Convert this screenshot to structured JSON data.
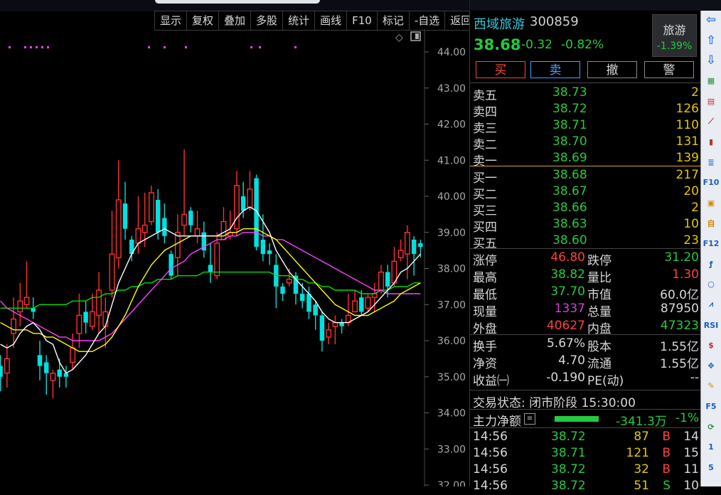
{
  "toolbar": [
    "显示",
    "复权",
    "叠加",
    "多股",
    "统计",
    "画线",
    "F10",
    "标记",
    "-自选",
    "返回"
  ],
  "stock": {
    "name": "西域旅游",
    "code": "300859",
    "price": "38.68",
    "change": "-0.32",
    "change_pct": "-0.82%"
  },
  "sector": {
    "name": "旅游",
    "change": "-1.39%"
  },
  "trade_buttons": [
    "买",
    "卖",
    "撤",
    "警"
  ],
  "asks": [
    {
      "label": "卖五",
      "price": "38.73",
      "vol": "2"
    },
    {
      "label": "卖四",
      "price": "38.72",
      "vol": "126"
    },
    {
      "label": "卖三",
      "price": "38.71",
      "vol": "110"
    },
    {
      "label": "卖二",
      "price": "38.70",
      "vol": "131"
    },
    {
      "label": "卖一",
      "price": "38.69",
      "vol": "139"
    }
  ],
  "bids": [
    {
      "label": "买一",
      "price": "38.68",
      "vol": "217"
    },
    {
      "label": "买二",
      "price": "38.67",
      "vol": "20"
    },
    {
      "label": "买三",
      "price": "38.66",
      "vol": "2"
    },
    {
      "label": "买四",
      "price": "38.63",
      "vol": "10"
    },
    {
      "label": "买五",
      "price": "38.60",
      "vol": "23"
    }
  ],
  "quotes_left": [
    {
      "label": "涨停",
      "value": "46.80",
      "color": "#ff4040"
    },
    {
      "label": "最高",
      "value": "38.82",
      "color": "#27c93f"
    },
    {
      "label": "最低",
      "value": "37.70",
      "color": "#27c93f"
    },
    {
      "label": "现量",
      "value": "1337",
      "color": "#d040d8"
    },
    {
      "label": "外盘",
      "value": "40627",
      "color": "#ff4040"
    }
  ],
  "quotes_right": [
    {
      "label": "跌停",
      "value": "31.20",
      "color": "#27c93f"
    },
    {
      "label": "量比",
      "value": "1.30",
      "color": "#ff4040"
    },
    {
      "label": "市值",
      "value": "60.0亿",
      "color": "#d8d8d8"
    },
    {
      "label": "总量",
      "value": "87950",
      "color": "#d8d8d8"
    },
    {
      "label": "内盘",
      "value": "47323",
      "color": "#27c93f"
    }
  ],
  "fund_left": [
    {
      "label": "换手",
      "value": "5.67%"
    },
    {
      "label": "净资",
      "value": "4.70"
    },
    {
      "label": "收益㈠",
      "value": "-0.190"
    }
  ],
  "fund_right": [
    {
      "label": "股本",
      "value": "1.55亿"
    },
    {
      "label": "流通",
      "value": "1.55亿"
    },
    {
      "label": "PE(动)",
      "value": "--"
    }
  ],
  "trade_status": "交易状态: 闭市阶段 15:30:00",
  "main_flow": {
    "label": "主力净额",
    "amount": "-341.3万",
    "pct": "-1%"
  },
  "ticks": [
    {
      "time": "14:56",
      "price": "38.72",
      "vol": "87",
      "bs": "B",
      "n": "14"
    },
    {
      "time": "14:56",
      "price": "38.71",
      "vol": "121",
      "bs": "B",
      "n": "15"
    },
    {
      "time": "14:56",
      "price": "38.72",
      "vol": "32",
      "bs": "B",
      "n": "11"
    },
    {
      "time": "14:56",
      "price": "38.72",
      "vol": "51",
      "bs": "S",
      "n": "10"
    }
  ],
  "sidebar_icons": [
    "arrow-left-icon",
    "arrow-up-icon",
    "arrow-down-icon",
    "grid-chart-icon",
    "table-icon",
    "line-chart-icon",
    "candle-icon",
    "list-icon",
    "f10-icon",
    "news-icon",
    "self-select-icon",
    "f12-icon",
    "formula-icon",
    "circle-icon",
    "indicator-icon",
    "rsi-icon",
    "money-icon",
    "move-icon",
    "pen-icon",
    "f5-icon",
    "refresh-icon",
    "num-1-icon",
    "num-5-icon"
  ],
  "sidebar_text": [
    "⇦",
    "⇧",
    "⇩",
    "▦",
    "▤",
    "⟋",
    "▮",
    "≣",
    "F10",
    "▣",
    "自",
    "F12",
    "ƒ",
    "○",
    "⩘",
    "RSI",
    "$",
    "✥",
    "✎",
    "F5",
    "⟳",
    "1",
    "5"
  ],
  "chart_data": {
    "type": "candlestick",
    "ylim": [
      32,
      44
    ],
    "y_ticks": [
      "44.00",
      "43.00",
      "42.00",
      "41.00",
      "40.00",
      "39.00",
      "38.00",
      "37.00",
      "36.00",
      "35.00",
      "34.00",
      "33.00",
      "32.00"
    ],
    "colors": {
      "up": "#ff3030",
      "down": "#00e0e0",
      "ma5": "#ffffff",
      "ma10": "#ffff00",
      "ma20": "#ff40ff",
      "ma60": "#00e000"
    },
    "candles": [
      [
        35.3,
        35.0,
        35.6,
        34.6
      ],
      [
        35.1,
        35.5,
        35.9,
        34.7
      ],
      [
        36.2,
        36.6,
        37.2,
        35.8
      ],
      [
        36.8,
        37.1,
        37.6,
        36.4
      ],
      [
        37.0,
        37.2,
        38.2,
        36.9
      ],
      [
        36.9,
        36.8,
        37.2,
        36.6
      ],
      [
        35.6,
        35.3,
        36.0,
        34.9
      ],
      [
        35.4,
        35.1,
        35.6,
        34.5
      ],
      [
        34.9,
        35.1,
        35.2,
        34.4
      ],
      [
        35.2,
        35.0,
        35.5,
        34.7
      ],
      [
        35.1,
        35.0,
        35.3,
        34.7
      ],
      [
        35.4,
        35.8,
        36.2,
        35.2
      ],
      [
        36.2,
        36.7,
        37.3,
        35.8
      ],
      [
        36.8,
        36.5,
        37.1,
        36.2
      ],
      [
        36.4,
        36.8,
        37.3,
        36.3
      ],
      [
        36.7,
        37.4,
        37.9,
        36.2
      ],
      [
        36.4,
        36.8,
        37.2,
        35.8
      ],
      [
        37.4,
        38.4,
        39.6,
        37.2
      ],
      [
        38.3,
        39.9,
        41.0,
        38.0
      ],
      [
        39.8,
        39.1,
        40.4,
        38.8
      ],
      [
        38.8,
        38.4,
        38.9,
        38.2
      ],
      [
        38.7,
        39.1,
        40.0,
        38.4
      ],
      [
        39.0,
        39.2,
        40.1,
        38.6
      ],
      [
        39.3,
        40.1,
        40.3,
        39.2
      ],
      [
        39.9,
        39.0,
        40.2,
        38.8
      ],
      [
        39.4,
        38.9,
        39.8,
        38.7
      ],
      [
        38.4,
        37.8,
        38.5,
        37.7
      ],
      [
        38.3,
        39.0,
        39.5,
        37.8
      ],
      [
        39.2,
        39.5,
        41.3,
        38.9
      ],
      [
        39.6,
        39.2,
        39.7,
        39.0
      ],
      [
        38.9,
        39.1,
        39.6,
        38.7
      ],
      [
        39.0,
        38.5,
        39.3,
        38.3
      ],
      [
        38.1,
        37.9,
        38.7,
        37.6
      ],
      [
        37.8,
        38.7,
        39.0,
        37.7
      ],
      [
        38.8,
        39.3,
        39.7,
        38.8
      ],
      [
        38.9,
        39.0,
        39.6,
        38.8
      ],
      [
        39.1,
        40.3,
        40.7,
        38.9
      ],
      [
        40.0,
        39.6,
        40.4,
        39.4
      ],
      [
        39.7,
        40.2,
        40.7,
        39.6
      ],
      [
        40.5,
        38.6,
        40.6,
        38.5
      ],
      [
        38.8,
        38.4,
        39.5,
        38.2
      ],
      [
        38.5,
        38.4,
        38.7,
        38.1
      ],
      [
        38.1,
        37.5,
        38.4,
        36.9
      ],
      [
        37.5,
        37.3,
        37.6,
        37.1
      ],
      [
        37.6,
        37.7,
        38.0,
        37.5
      ],
      [
        37.8,
        37.3,
        37.9,
        37.0
      ],
      [
        37.3,
        37.1,
        37.6,
        36.9
      ],
      [
        37.3,
        36.8,
        37.5,
        36.6
      ],
      [
        37.0,
        36.7,
        37.1,
        36.3
      ],
      [
        36.7,
        36.0,
        36.8,
        35.7
      ],
      [
        36.1,
        36.3,
        36.5,
        35.9
      ],
      [
        36.4,
        36.5,
        36.7,
        35.9
      ],
      [
        36.5,
        36.4,
        36.6,
        36.2
      ],
      [
        36.5,
        36.7,
        37.3,
        36.4
      ],
      [
        36.8,
        37.1,
        37.4,
        36.8
      ],
      [
        37.2,
        36.8,
        37.4,
        36.7
      ],
      [
        36.9,
        37.2,
        37.3,
        36.8
      ],
      [
        37.2,
        37.3,
        37.6,
        36.8
      ],
      [
        37.4,
        37.9,
        38.1,
        37.3
      ],
      [
        37.9,
        37.5,
        38.1,
        37.2
      ],
      [
        37.6,
        38.2,
        38.6,
        37.5
      ],
      [
        38.3,
        38.5,
        38.8,
        38.2
      ],
      [
        38.4,
        39.0,
        39.2,
        37.7
      ],
      [
        38.8,
        38.4,
        38.9,
        37.8
      ],
      [
        38.7,
        38.6,
        38.8,
        38.3
      ]
    ],
    "ma5": [
      35.9,
      35.8,
      35.9,
      36.2,
      36.4,
      36.5,
      36.3,
      36.0,
      35.9,
      35.4,
      35.1,
      35.2,
      35.4,
      35.6,
      35.9,
      36.2,
      36.4,
      37.0,
      37.6,
      38.0,
      38.4,
      38.7,
      38.8,
      38.9,
      39.0,
      39.1,
      39.0,
      38.9,
      38.9,
      38.9,
      38.9,
      38.9,
      38.9,
      38.9,
      39.0,
      39.1,
      39.4,
      39.6,
      39.7,
      39.6,
      39.3,
      39.0,
      38.5,
      38.2,
      37.9,
      37.7,
      37.5,
      37.3,
      37.1,
      36.8,
      36.6,
      36.5,
      36.5,
      36.5,
      36.6,
      36.7,
      36.8,
      37.0,
      37.2,
      37.4,
      37.6,
      37.9,
      38.0,
      38.2,
      38.4
    ],
    "ma10": [
      36.5,
      36.4,
      36.3,
      36.3,
      36.3,
      36.2,
      36.2,
      36.1,
      36.1,
      36.0,
      35.9,
      35.8,
      35.7,
      35.7,
      35.7,
      35.8,
      35.9,
      36.1,
      36.4,
      36.7,
      37.1,
      37.5,
      37.8,
      38.1,
      38.3,
      38.5,
      38.6,
      38.7,
      38.8,
      38.9,
      38.9,
      38.9,
      38.9,
      38.9,
      38.9,
      39.0,
      39.0,
      39.1,
      39.1,
      39.1,
      39.0,
      38.9,
      38.8,
      38.6,
      38.4,
      38.2,
      38.0,
      37.8,
      37.6,
      37.4,
      37.2,
      37.0,
      36.9,
      36.8,
      36.7,
      36.7,
      36.7,
      36.8,
      36.9,
      37.0,
      37.1,
      37.3,
      37.4,
      37.5,
      37.6
    ],
    "ma20": [
      37.1,
      36.9,
      36.8,
      36.7,
      36.6,
      36.5,
      36.4,
      36.3,
      36.2,
      36.1,
      36.1,
      36.0,
      36.0,
      36.0,
      36.0,
      36.0,
      36.1,
      36.2,
      36.4,
      36.6,
      36.8,
      37.0,
      37.2,
      37.4,
      37.6,
      37.8,
      38.0,
      38.1,
      38.2,
      38.4,
      38.5,
      38.6,
      38.7,
      38.8,
      38.8,
      38.9,
      38.9,
      39.0,
      39.0,
      39.0,
      38.9,
      38.9,
      38.8,
      38.8,
      38.7,
      38.6,
      38.5,
      38.4,
      38.3,
      38.2,
      38.1,
      38.0,
      37.9,
      37.8,
      37.7,
      37.6,
      37.5,
      37.4,
      37.4,
      37.3,
      37.3,
      37.3,
      37.3,
      37.3,
      37.3
    ],
    "ma60": [
      36.9,
      36.9,
      36.9,
      36.9,
      36.9,
      36.9,
      37.0,
      37.0,
      37.0,
      37.0,
      37.0,
      37.1,
      37.1,
      37.1,
      37.2,
      37.2,
      37.3,
      37.3,
      37.4,
      37.4,
      37.5,
      37.5,
      37.6,
      37.6,
      37.7,
      37.7,
      37.7,
      37.8,
      37.8,
      37.8,
      37.8,
      37.9,
      37.9,
      37.9,
      37.9,
      37.9,
      37.9,
      37.9,
      37.9,
      37.9,
      37.9,
      37.9,
      37.8,
      37.8,
      37.8,
      37.7,
      37.7,
      37.6,
      37.6,
      37.5,
      37.5,
      37.4,
      37.4,
      37.4,
      37.4,
      37.3,
      37.3,
      37.3,
      37.4,
      37.4,
      37.5,
      37.5,
      37.5,
      37.6,
      37.6
    ]
  }
}
